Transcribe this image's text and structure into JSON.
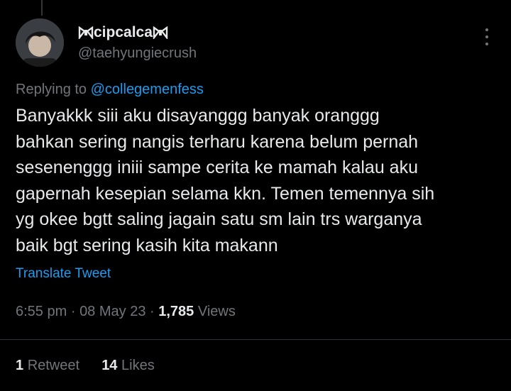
{
  "author": {
    "display_name": "cipcalca",
    "handle": "@taehyungiecrush"
  },
  "reply": {
    "prefix": "Replying to",
    "mention": "@collegemenfess"
  },
  "tweet": {
    "text": "Banyakkk siii aku disayanggg banyak oranggg\nbahkan sering nangis terharu karena belum pernah\nsesenenggg iniii sampe cerita ke mamah kalau aku\ngapernah kesepian selama kkn. Temen temennya sih\nyg okee bgtt saling jagain satu sm lain trs warganya\nbaik bgt sering kasih kita makann",
    "translate_label": "Translate Tweet"
  },
  "meta": {
    "time": "6:55 pm",
    "separator": "·",
    "date": "08 May 23",
    "views_count": "1,785",
    "views_label": "Views"
  },
  "stats": {
    "retweets_count": "1",
    "retweets_label": "Retweet",
    "likes_count": "14",
    "likes_label": "Likes"
  },
  "icons": {
    "name_decoration": "ribbon-bow-icon",
    "more": "more-options-icon"
  },
  "colors": {
    "background": "#000000",
    "text": "#e7e9ea",
    "secondary": "#71767b",
    "link": "#1d9bf0"
  }
}
